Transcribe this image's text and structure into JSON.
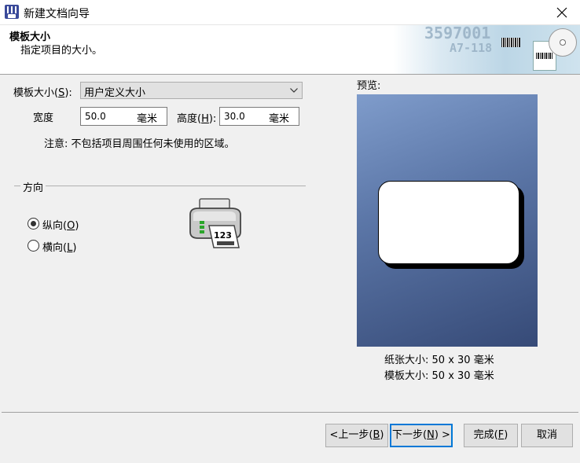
{
  "window": {
    "title": "新建文档向导"
  },
  "header": {
    "title": "模板大小",
    "subtitle": "指定项目的大小。",
    "banner_texts": [
      "3597001",
      "A7-118"
    ]
  },
  "template_size": {
    "label": "模板大小(S):",
    "label_main": "模板大小(",
    "label_key": "S",
    "label_end": "):",
    "selected": "用户定义大小"
  },
  "width": {
    "label": "宽度",
    "value": "50.0",
    "unit": "毫米"
  },
  "height": {
    "label_main": "高度(",
    "label_key": "H",
    "label_end": "):",
    "value": "30.0",
    "unit": "毫米"
  },
  "note": "注意: 不包括项目周围任何未使用的区域。",
  "orientation": {
    "title": "方向",
    "options": [
      {
        "main": "纵向(",
        "key": "O",
        "end": ")",
        "selected": true
      },
      {
        "main": "横向(",
        "key": "L",
        "end": ")",
        "selected": false
      }
    ],
    "printer_paper_text": "123"
  },
  "preview": {
    "label": "预览:",
    "paper_size_label": "纸张大小:",
    "paper_size_value": "50 x 30 毫米",
    "template_size_label": "模板大小:",
    "template_size_value": "50 x 30 毫米"
  },
  "buttons": {
    "back": {
      "main": "<上一步(",
      "key": "B",
      "end": ")"
    },
    "next": {
      "main": "下一步(",
      "key": "N",
      "end": ") >"
    },
    "finish": {
      "main": "完成(",
      "key": "F",
      "end": ")"
    },
    "cancel": "取消"
  },
  "colors": {
    "accent": "#0078d7",
    "preview_top": "#7f9ccb",
    "preview_bottom": "#364a77"
  }
}
